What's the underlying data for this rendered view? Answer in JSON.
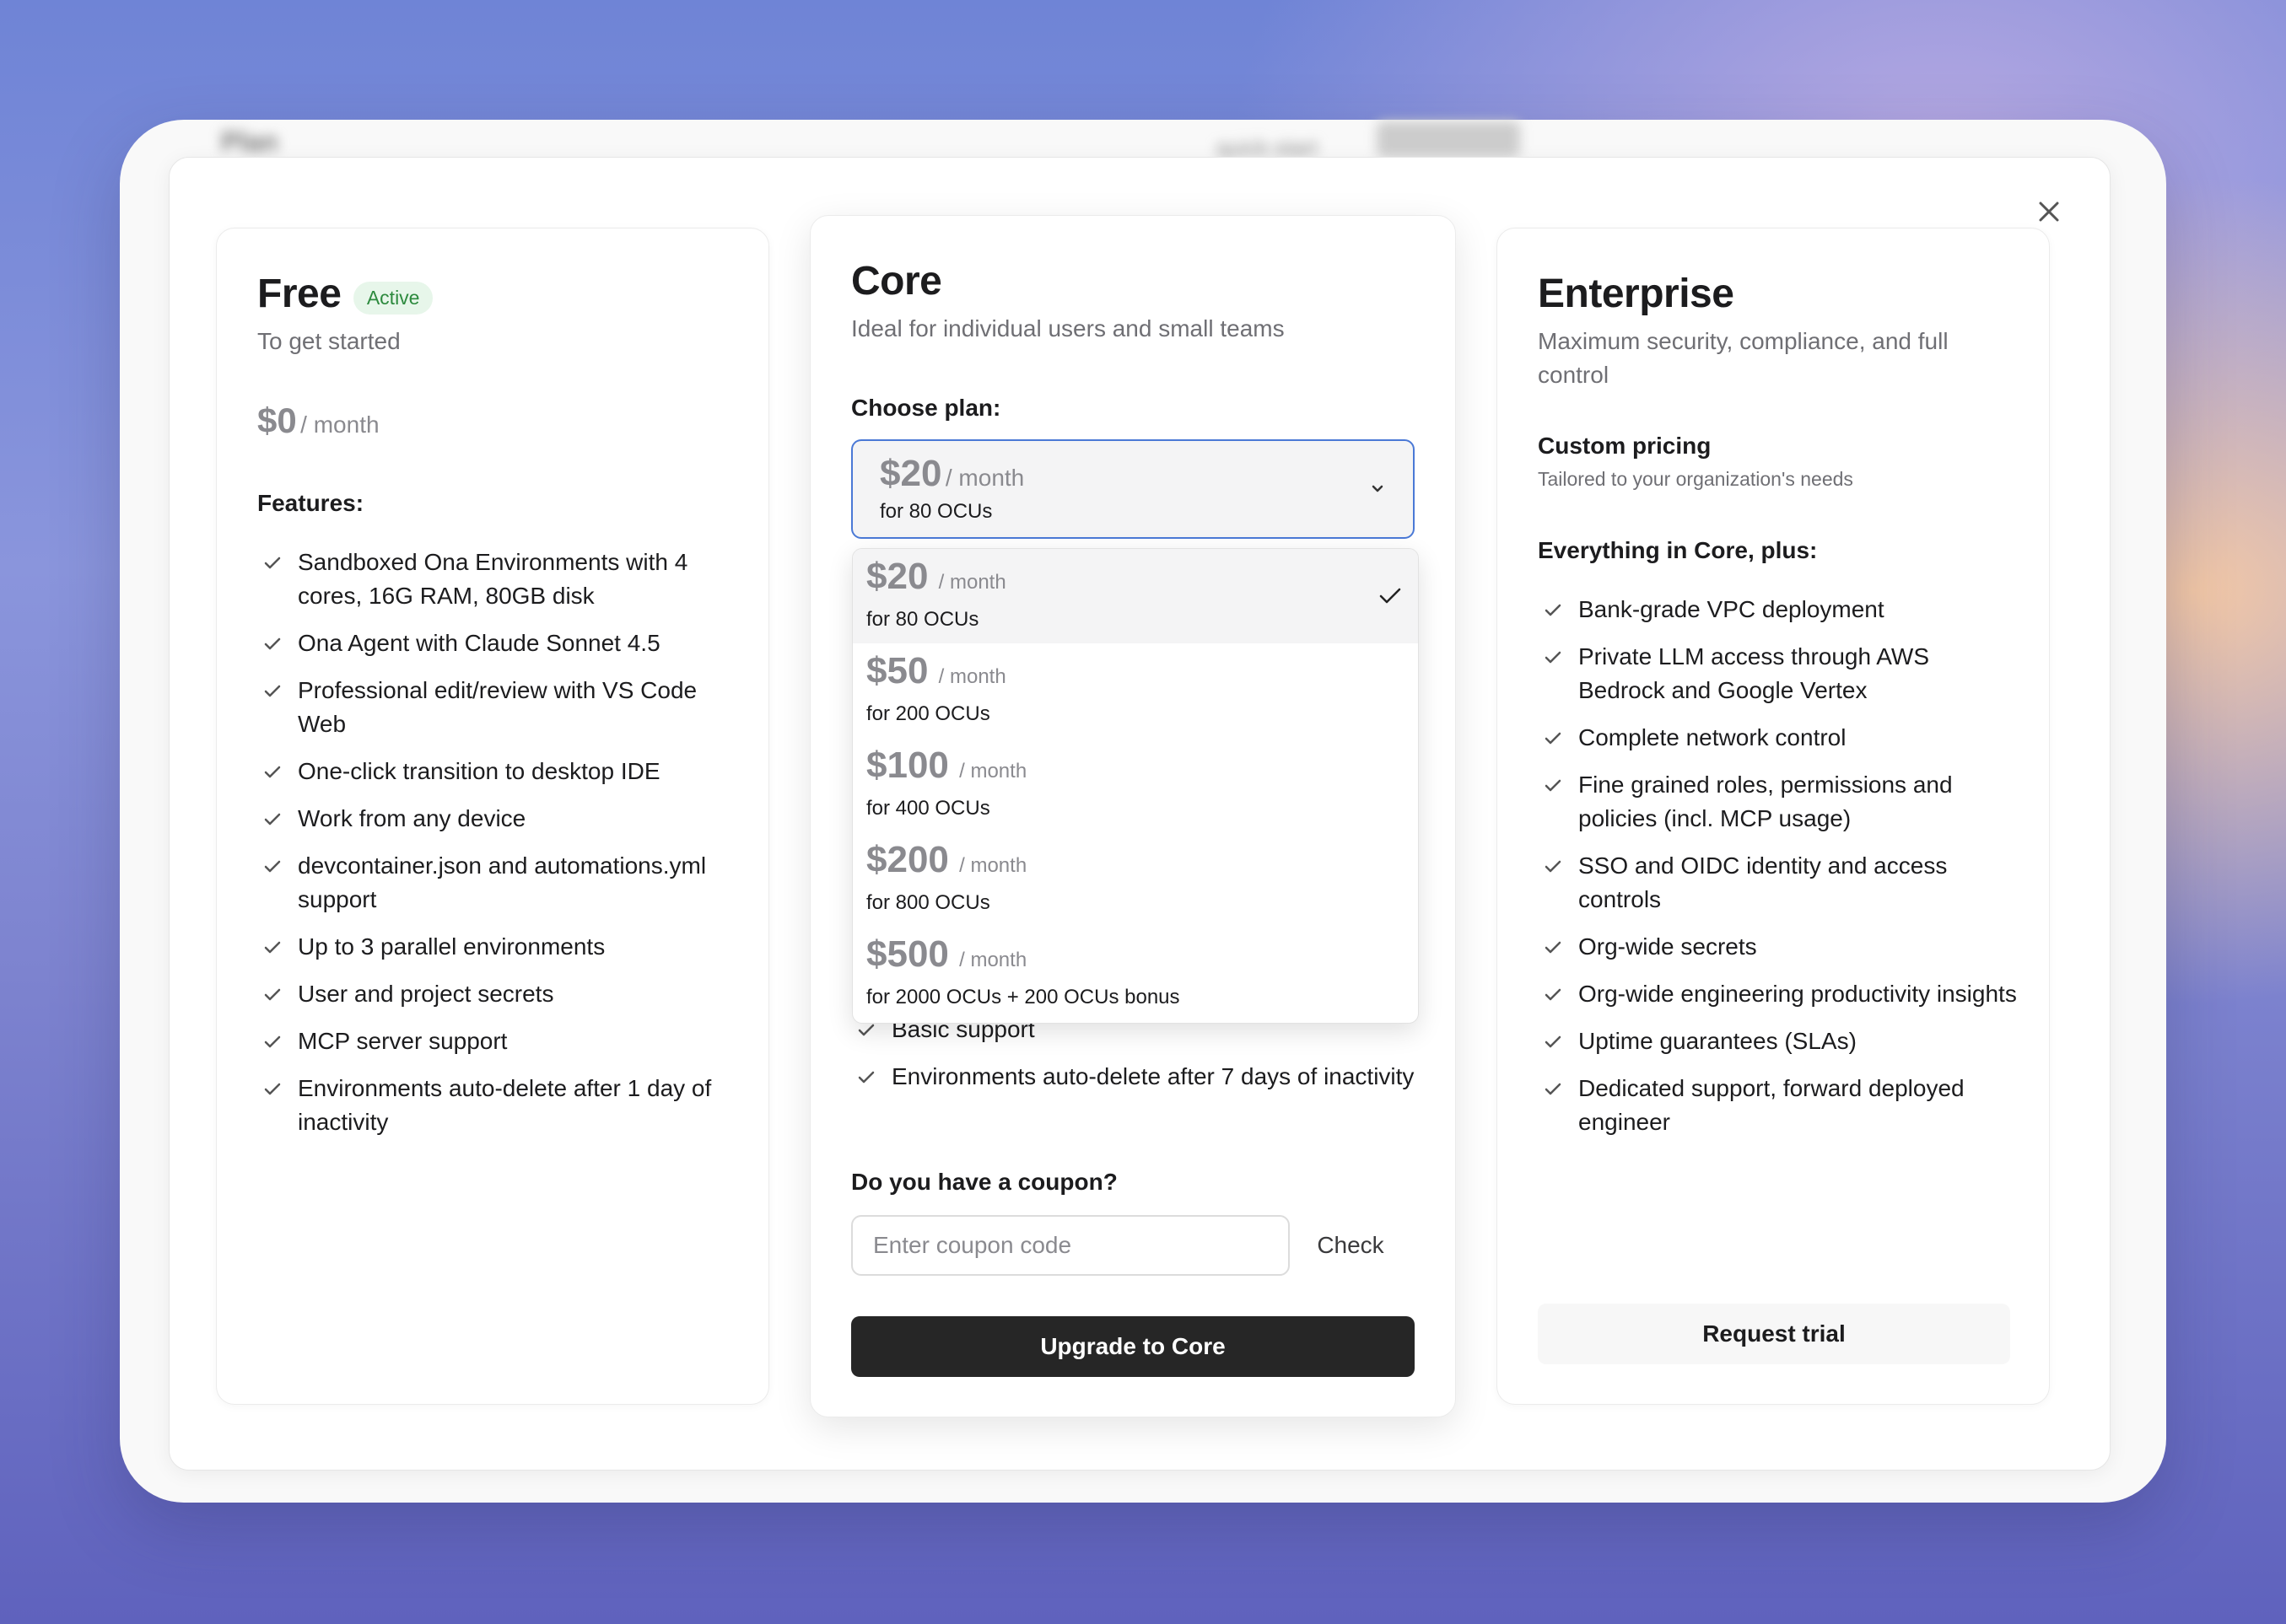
{
  "background_app": {
    "title": "Plan",
    "link": "quick-start",
    "button": ""
  },
  "modal": {
    "close_label": "×"
  },
  "free": {
    "name": "Free",
    "badge": "Active",
    "tagline": "To get started",
    "price": "$0",
    "period": "/ month",
    "features_label": "Features:",
    "features": [
      "Sandboxed Ona Environments with 4 cores, 16G RAM, 80GB disk",
      "Ona Agent with Claude Sonnet 4.5",
      "Professional edit/review with VS Code Web",
      "One-click transition to desktop IDE",
      "Work from any device",
      "devcontainer.json and automations.yml support",
      "Up to 3 parallel environments",
      "User and project secrets",
      "MCP server support",
      "Environments auto-delete after 1 day of inactivity"
    ]
  },
  "core": {
    "name": "Core",
    "tagline": "Ideal for individual users and small teams",
    "choose_label": "Choose plan:",
    "selected": {
      "price": "$20",
      "period": "/ month",
      "sub": "for 80 OCUs"
    },
    "options": [
      {
        "price": "$20",
        "period": "/ month",
        "sub": "for 80 OCUs",
        "selected": true
      },
      {
        "price": "$50",
        "period": "/ month",
        "sub": "for 200 OCUs",
        "selected": false
      },
      {
        "price": "$100",
        "period": "/ month",
        "sub": "for 400 OCUs",
        "selected": false
      },
      {
        "price": "$200",
        "period": "/ month",
        "sub": "for 800 OCUs",
        "selected": false
      },
      {
        "price": "$500",
        "period": "/ month",
        "sub": "for 2000 OCUs + 200 OCUs bonus",
        "selected": false
      }
    ],
    "features_visible": [
      "Basic support",
      "Environments auto-delete after 7 days of inactivity"
    ],
    "coupon_label": "Do you have a coupon?",
    "coupon_placeholder": "Enter coupon code",
    "coupon_value": "",
    "check_label": "Check",
    "upgrade_label": "Upgrade to Core"
  },
  "enterprise": {
    "name": "Enterprise",
    "tagline": "Maximum security, compliance, and full control",
    "pricing_title": "Custom pricing",
    "pricing_sub": "Tailored to your organization's needs",
    "features_label": "Everything in Core, plus:",
    "features": [
      "Bank-grade VPC deployment",
      "Private LLM access through AWS Bedrock and Google Vertex",
      "Complete network control",
      "Fine grained roles, permissions and policies (incl. MCP usage)",
      "SSO and OIDC identity and access controls",
      "Org-wide secrets",
      "Org-wide engineering productivity insights",
      "Uptime guarantees (SLAs)",
      "Dedicated support, forward deployed engineer"
    ],
    "trial_label": "Request trial"
  },
  "colors": {
    "accent_border": "#4a79d6",
    "primary_button": "#262626",
    "active_badge_bg": "#e7f6ea",
    "active_badge_text": "#2d8a3e"
  }
}
